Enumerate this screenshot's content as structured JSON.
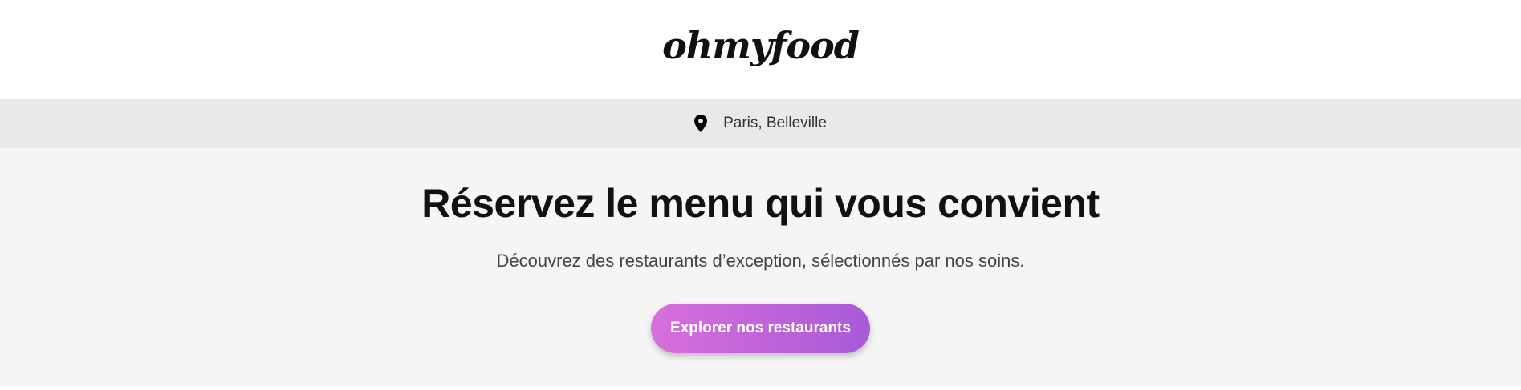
{
  "header": {
    "logo_text": "ohmyfood"
  },
  "location": {
    "icon": "map-pin-icon",
    "text": "Paris, Belleville"
  },
  "hero": {
    "title": "Réservez le menu qui vous convient",
    "subtitle": "Découvrez des restaurants d’exception, sélectionnés par nos soins.",
    "cta_label": "Explorer nos restaurants"
  },
  "colors": {
    "cta_gradient_start": "#d86fdb",
    "cta_gradient_end": "#a95ad8",
    "location_bar_bg": "#e9e9e9",
    "hero_bg": "#f5f5f5"
  }
}
